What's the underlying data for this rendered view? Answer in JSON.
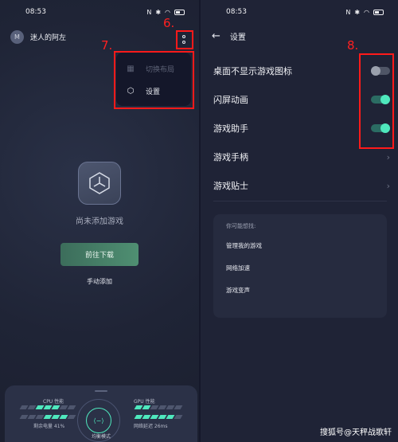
{
  "status": {
    "left_time": "08:53",
    "right_time": "08:53"
  },
  "left": {
    "username": "迷人的阿左",
    "avatar_letter": "M",
    "annotation_more": "6.",
    "annotation_menu": "7.",
    "menu": {
      "items": [
        {
          "label": "切换布局",
          "icon": "grid-icon",
          "disabled": true
        },
        {
          "label": "设置",
          "icon": "settings-hex-icon",
          "disabled": false
        }
      ]
    },
    "empty_text": "尚未添加游戏",
    "download_label": "前往下载",
    "manual_label": "手动添加",
    "bottom": {
      "cpu_label": "CPU 性能",
      "gpu_label": "GPU 性能",
      "battery_label": "剩余电量 41%",
      "latency_label": "网络延迟 26ms",
      "mode_label": "均衡模式"
    }
  },
  "right": {
    "title": "设置",
    "annotation_toggles": "8.",
    "rows": [
      {
        "label": "桌面不显示游戏图标",
        "type": "toggle",
        "on": false
      },
      {
        "label": "闪屏动画",
        "type": "toggle",
        "on": true
      },
      {
        "label": "游戏助手",
        "type": "toggle",
        "on": true
      },
      {
        "label": "游戏手柄",
        "type": "link"
      },
      {
        "label": "游戏贴士",
        "type": "link"
      }
    ],
    "suggest": {
      "title": "你可能想找:",
      "items": [
        "管理我的游戏",
        "网络加速",
        "游戏变声"
      ]
    }
  },
  "watermark": "搜狐号@天秤战歌轩",
  "colors": {
    "accent": "#4fe8bd",
    "annotation": "#ff1a1a",
    "background": "#1e2233"
  }
}
